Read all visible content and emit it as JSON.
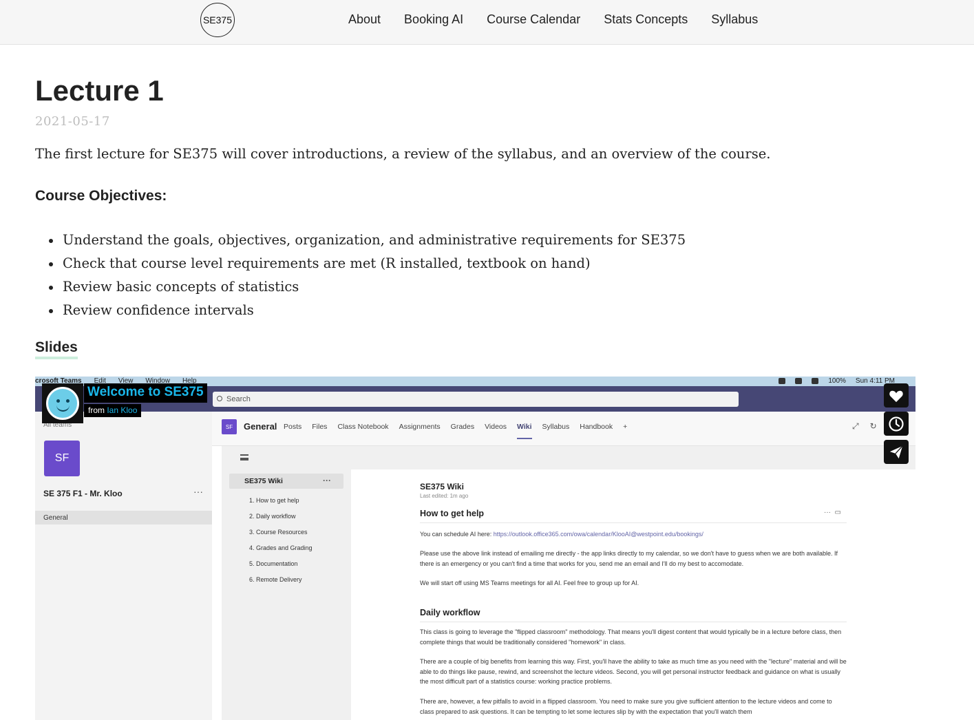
{
  "site": {
    "logo_text": "SE375",
    "nav": [
      "About",
      "Booking AI",
      "Course Calendar",
      "Stats Concepts",
      "Syllabus"
    ]
  },
  "post": {
    "title": "Lecture 1",
    "date": "2021-05-17",
    "intro": "The first lecture for SE375 will cover introductions, a review of the syllabus, and an overview of the course.",
    "objectives_heading": "Course Objectives:",
    "objectives": [
      "Understand the goals, objectives, organization, and administrative requirements for SE375",
      "Check that course level requirements are met (R installed, textbook on hand)",
      "Review basic concepts of statistics",
      "Review confidence intervals"
    ],
    "slides_label": "Slides"
  },
  "video": {
    "title": "Welcome to SE375",
    "from_label": "from",
    "author": "Ian Kloo",
    "buttons": [
      "like-icon",
      "watch-later-icon",
      "share-icon"
    ],
    "screen": {
      "mac_menu": [
        "crosoft Teams",
        "Edit",
        "View",
        "Window",
        "Help"
      ],
      "mac_status": "100%",
      "mac_clock": "Sun 4:11 PM",
      "search_placeholder": "Search",
      "all_teams": "All teams",
      "team_initials": "SF",
      "team_name": "SE 375 F1 - Mr. Kloo",
      "team_more": "···",
      "channel_general": "General",
      "channel_name": "General",
      "tabs": [
        "Posts",
        "Files",
        "Class Notebook",
        "Assignments",
        "Grades",
        "Videos",
        "Wiki",
        "Syllabus",
        "Handbook",
        "+"
      ],
      "active_tab": "Wiki",
      "wiki_header": "SE375 Wiki",
      "wiki_header_more": "···",
      "wiki_sections": [
        "1. How to get help",
        "2. Daily workflow",
        "3. Course Resources",
        "4. Grades and Grading",
        "5. Documentation",
        "6. Remote Delivery"
      ],
      "page_title": "SE375 Wiki",
      "last_edited": "Last edited: 1m ago",
      "section1_title": "How to get help",
      "section1_p1_prefix": "You can schedule AI here: ",
      "section1_p1_link": "https://outlook.office365.com/owa/calendar/KlooAI@westpoint.edu/bookings/",
      "section1_p2": "Please use the above link instead of emailing me directly - the app links directly to my calendar, so we don't have to guess when we are both available.  If there is an emergency or you can't find a time that works for you, send me an email and I'll do my best to accomodate.",
      "section1_p3": "We will start off using MS Teams meetings for all AI.  Feel free to group up for AI.",
      "section2_title": "Daily workflow",
      "section2_p1": "This class is going to leverage the \"flipped classroom\" methodology.  That means you'll digest content that would typically be in a lecture before class, then complete things that would be traditionally considered \"homework\" in class.",
      "section2_p2": "There are a couple of big benefits from learning this way.  First, you'll have the ability to take as much time as you need with the \"lecture\" material and will be able to do things like pause, rewind, and screenshot the lecture videos.  Second, you will get personal instructor feedback and guidance on what is usually the most difficult part of a statistics course: working practice problems.",
      "section2_p3": "There are, however, a few pitfalls to avoid in a flipped classroom.  You need to make sure you give sufficient attention to the lecture videos and come to class prepared to ask questions.  It can be tempting to let some lectures slip by with the expectation that you'll watch them"
    }
  }
}
